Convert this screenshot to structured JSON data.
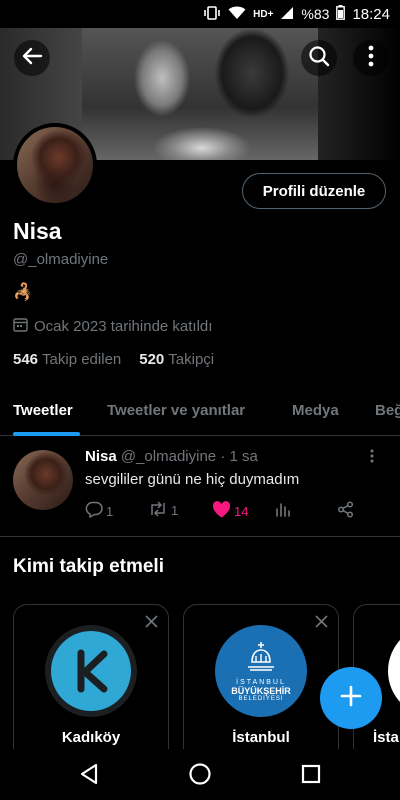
{
  "statusbar": {
    "network": "HD+",
    "battery": "%83",
    "time": "18:24"
  },
  "header": {
    "back_icon": "arrow-left-icon",
    "search_icon": "search-icon",
    "more_icon": "more-vertical-icon"
  },
  "profile": {
    "edit_label": "Profili düzenle",
    "name": "Nisa",
    "handle": "@_olmadiyine",
    "bio_emoji": "🦂",
    "joined": "Ocak 2023 tarihinde katıldı",
    "following_count": "546",
    "following_label": "Takip edilen",
    "followers_count": "520",
    "followers_label": "Takipçi"
  },
  "tabs": [
    {
      "label": "Tweetler",
      "active": true
    },
    {
      "label": "Tweetler ve yanıtlar",
      "active": false
    },
    {
      "label": "Medya",
      "active": false
    },
    {
      "label": "Beğ",
      "active": false
    }
  ],
  "tweet": {
    "name": "Nisa",
    "handle": "@_olmadiyine",
    "separator": "·",
    "time": "1 sa",
    "text": "sevgililer günü ne hiç duymadım",
    "replies": "1",
    "retweets": "1",
    "likes": "14"
  },
  "who_to_follow": {
    "title": "Kimi takip etmeli",
    "cards": [
      {
        "name": "Kadıköy"
      },
      {
        "name": "İstanbul",
        "logo_line1": "İSTANBUL",
        "logo_line2": "BÜYÜKŞEHİR",
        "logo_line3": "BELEDİYESİ"
      },
      {
        "name": "İsta"
      }
    ]
  },
  "colors": {
    "accent": "#1d9bf0",
    "like": "#f91880",
    "muted": "#71767b"
  }
}
